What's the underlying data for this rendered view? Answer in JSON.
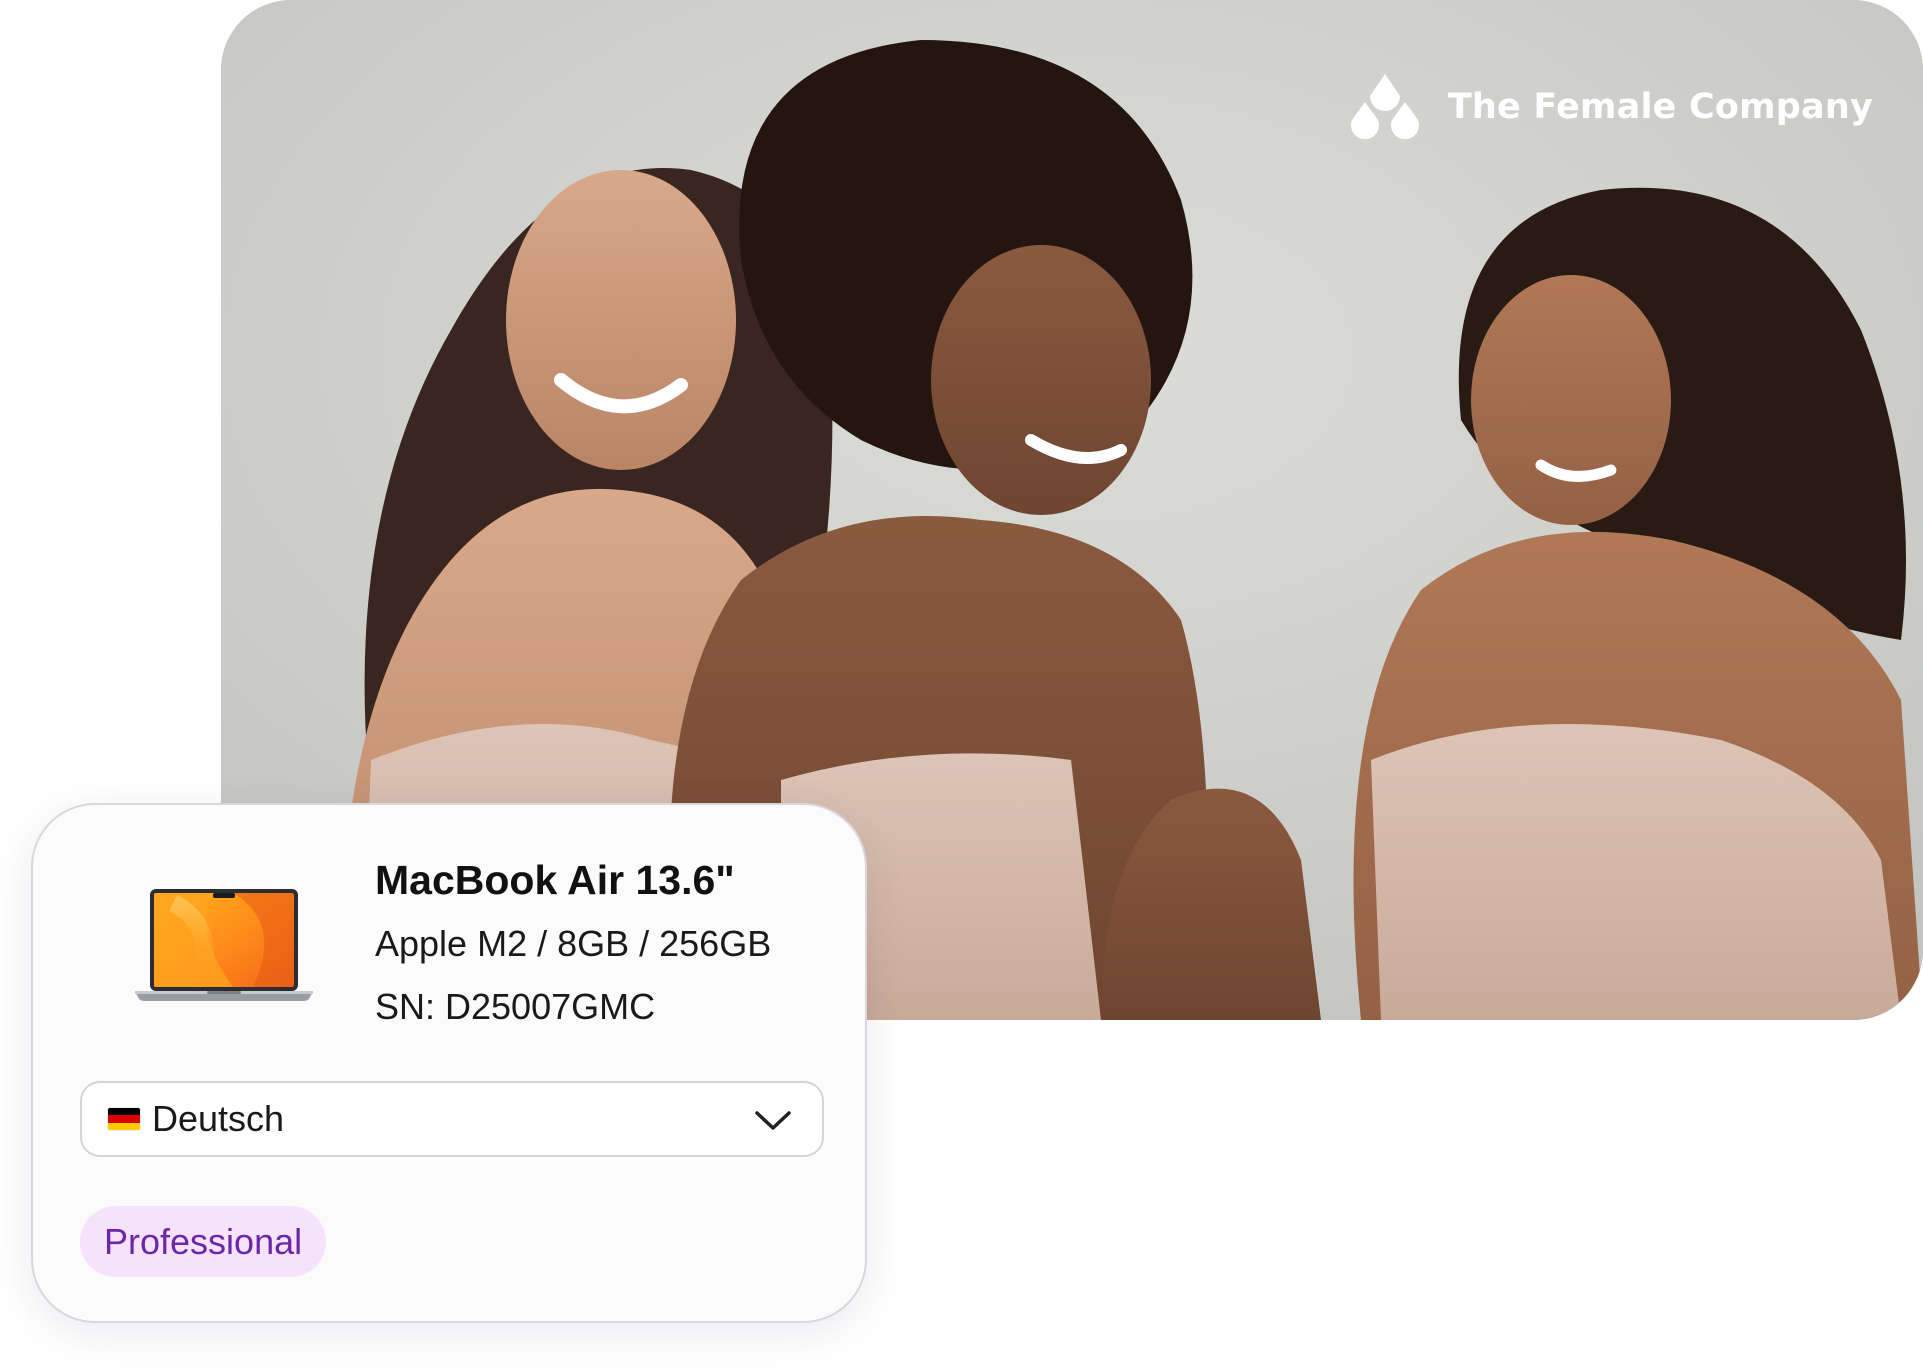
{
  "hero": {
    "brand_name": "The Female Company",
    "brand_icon": "water-drops-logo",
    "image_description_icon": "hero-photo"
  },
  "device_card": {
    "icon": "laptop-icon",
    "name": "MacBook Air 13.6\"",
    "spec": "Apple M2 / 8GB / 256GB",
    "serial": "SN: D25007GMC",
    "language_select": {
      "flag_icon": "germany-flag-icon",
      "value": "Deutsch",
      "chevron_icon": "chevron-down-icon"
    },
    "badge": "Professional"
  },
  "colors": {
    "badge_bg": "#f4e3fb",
    "badge_text": "#6d26a8",
    "card_border": "#d9d6dc",
    "hero_bg": "#c9cac6"
  }
}
